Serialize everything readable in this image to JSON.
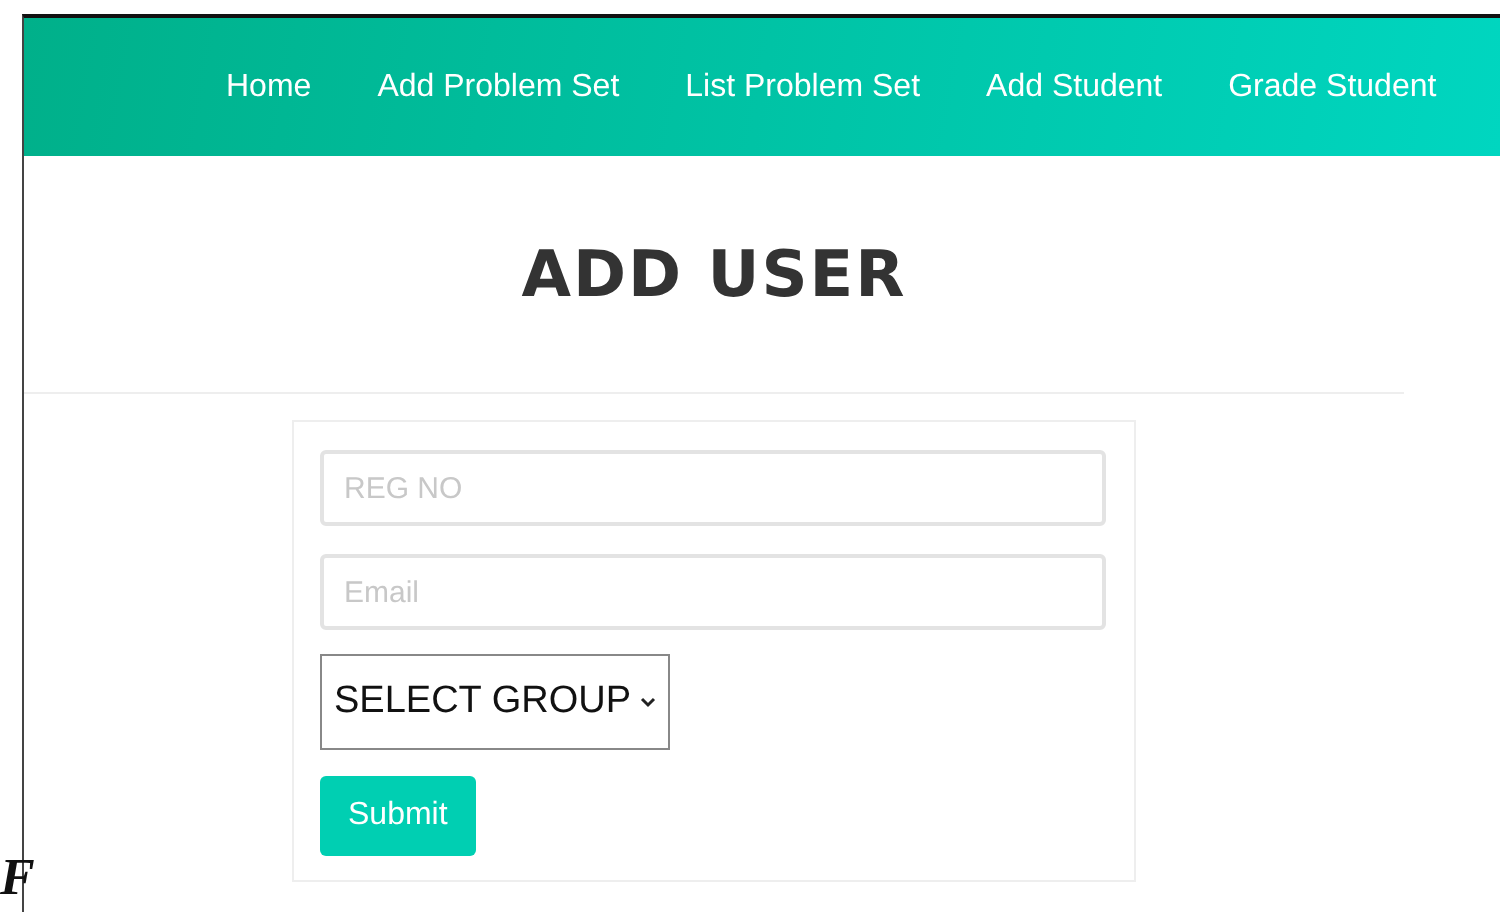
{
  "nav": {
    "items": [
      {
        "label": "Home"
      },
      {
        "label": "Add Problem Set"
      },
      {
        "label": "List Problem Set"
      },
      {
        "label": "Add Student"
      },
      {
        "label": "Grade Student"
      }
    ]
  },
  "page": {
    "title": "ADD USER"
  },
  "form": {
    "fields": [
      {
        "kind": "input",
        "placeholder": "REG NO"
      },
      {
        "kind": "input",
        "placeholder": "Email"
      },
      {
        "kind": "select",
        "value": "SELECT GROUP"
      }
    ],
    "submit": "Submit"
  },
  "fragment": {
    "text": "F"
  }
}
